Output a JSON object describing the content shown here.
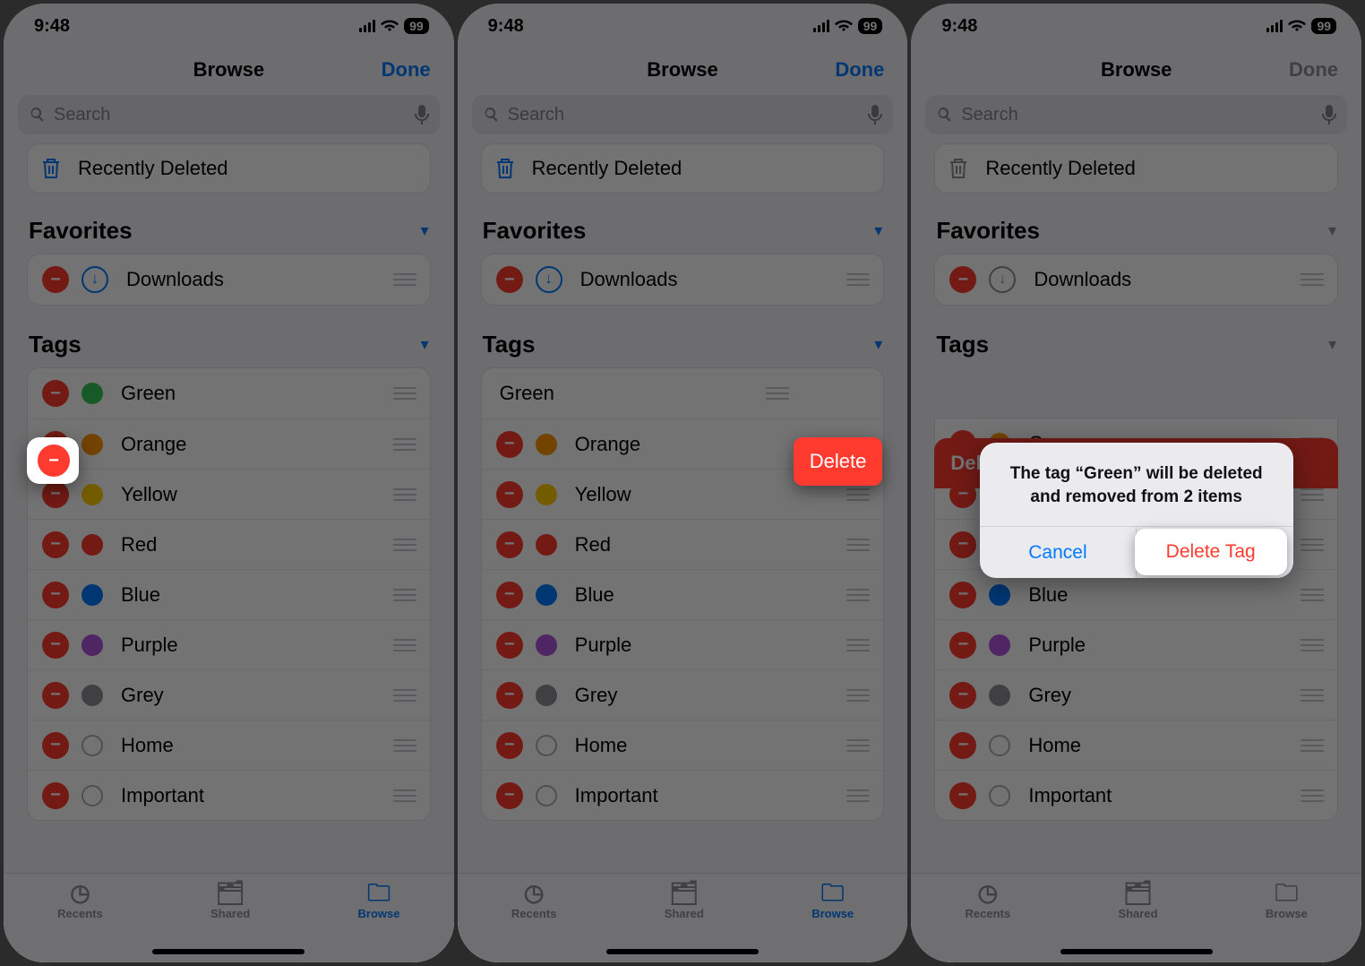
{
  "status": {
    "time": "9:48",
    "battery": "99"
  },
  "nav": {
    "title": "Browse",
    "done": "Done"
  },
  "search": {
    "placeholder": "Search"
  },
  "recently_deleted": "Recently Deleted",
  "sections": {
    "favorites": "Favorites",
    "tags": "Tags"
  },
  "favorites": {
    "downloads": "Downloads"
  },
  "tags": [
    {
      "label": "Green",
      "color": "#34c759"
    },
    {
      "label": "Orange",
      "color": "#ff9500"
    },
    {
      "label": "Yellow",
      "color": "#ffcc00"
    },
    {
      "label": "Red",
      "color": "#ff3b30"
    },
    {
      "label": "Blue",
      "color": "#007aff"
    },
    {
      "label": "Purple",
      "color": "#af52de"
    },
    {
      "label": "Grey",
      "color": "#8e8e93"
    },
    {
      "label": "Home",
      "color": "hollow"
    },
    {
      "label": "Important",
      "color": "hollow"
    }
  ],
  "tabbar": {
    "recents": "Recents",
    "shared": "Shared",
    "browse": "Browse"
  },
  "swipe": {
    "delete": "Delete",
    "delete_bg": "Del..."
  },
  "alert": {
    "message": "The tag “Green” will be deleted and removed from 2 items",
    "cancel": "Cancel",
    "delete": "Delete Tag"
  }
}
